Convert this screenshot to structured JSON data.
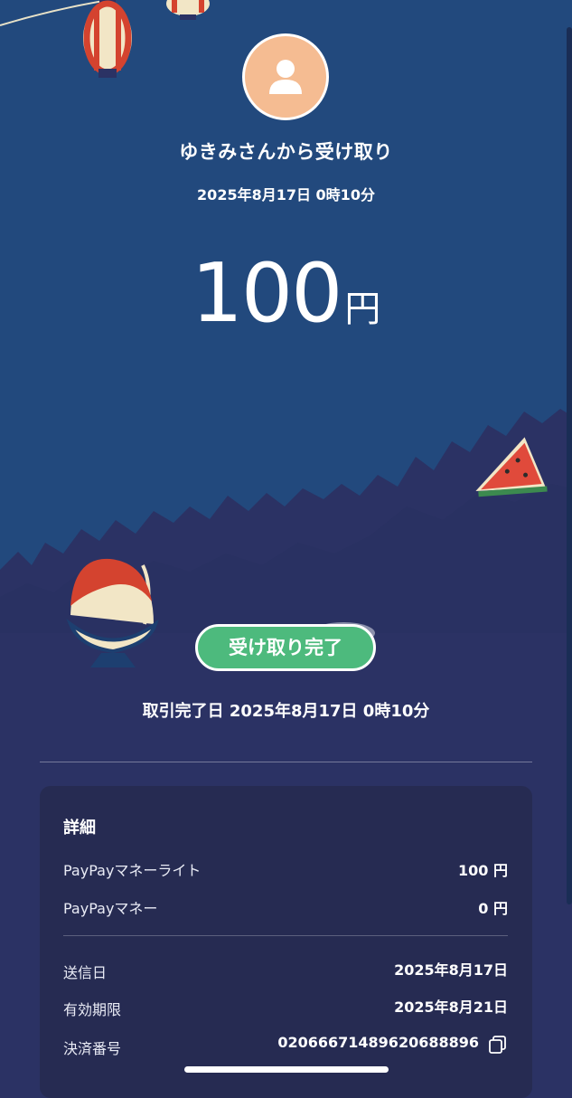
{
  "header": {
    "title": "ゆきみさんから受け取り",
    "datetime": "2025年8月17日 0時10分"
  },
  "amount": {
    "value": "100",
    "unit": "円"
  },
  "status": {
    "badge": "受け取り完了",
    "completion_label": "取引完了日",
    "completion_datetime": "2025年8月17日 0時10分"
  },
  "details": {
    "title": "詳細",
    "rows": [
      {
        "label": "PayPayマネーライト",
        "value": "100 円"
      },
      {
        "label": "PayPayマネー",
        "value": "0 円"
      },
      {
        "label": "送信日",
        "value": "2025年8月17日"
      },
      {
        "label": "有効期限",
        "value": "2025年8月21日"
      },
      {
        "label": "決済番号",
        "value": "02066671489620688896"
      }
    ]
  },
  "icons": [
    "avatar-person-icon",
    "copy-icon",
    "lantern-icon",
    "watermelon-icon",
    "shaved-ice-icon",
    "beer-mug-icon",
    "mosquito-coil-icon"
  ],
  "colors": {
    "sky": "#22497d",
    "ground": "#2b3264",
    "badge": "#4dba7d",
    "avatar": "#f5bc92"
  }
}
